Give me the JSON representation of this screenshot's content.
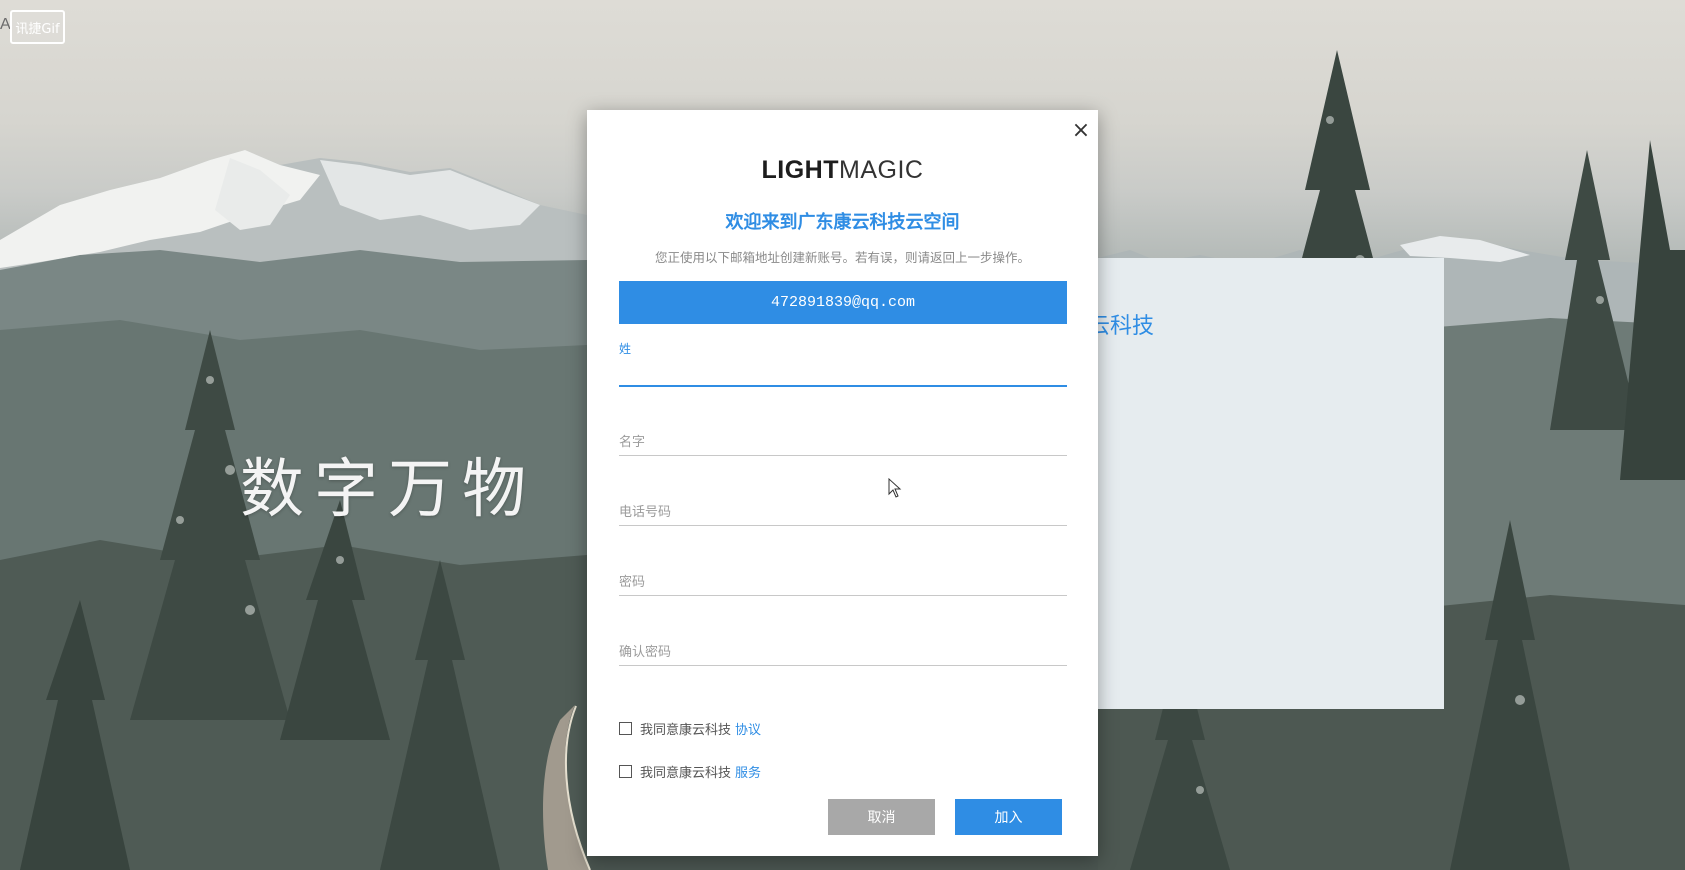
{
  "watermark": {
    "label": "讯捷Gif",
    "corner_letter": "A"
  },
  "background": {
    "hero_text": "数字万物",
    "back_card_title": "云科技"
  },
  "modal": {
    "close_label": "×",
    "logo": {
      "bold": "LIGHT",
      "light": "MAGIC"
    },
    "welcome": "欢迎来到广东康云科技云空间",
    "subtitle": "您正使用以下邮箱地址创建新账号。若有误，则请返回上一步操作。",
    "email": "472891839@qq.com",
    "fields": [
      {
        "label": "姓",
        "value": "",
        "active": true
      },
      {
        "label": "名字",
        "value": ""
      },
      {
        "label": "电话号码",
        "value": ""
      },
      {
        "label": "密码",
        "value": ""
      },
      {
        "label": "确认密码",
        "value": ""
      }
    ],
    "agreements": [
      {
        "text": "我同意康云科技",
        "link": "协议",
        "checked": false
      },
      {
        "text": "我同意康云科技",
        "link": "服务",
        "checked": false
      }
    ],
    "buttons": {
      "cancel": "取消",
      "join": "加入"
    }
  },
  "colors": {
    "accent": "#2f8de4",
    "cancel": "#a8a8a8",
    "back_card": "#e6ecef"
  },
  "icons": [
    "close-icon",
    "checkbox-icon",
    "mouse-pointer-icon"
  ]
}
